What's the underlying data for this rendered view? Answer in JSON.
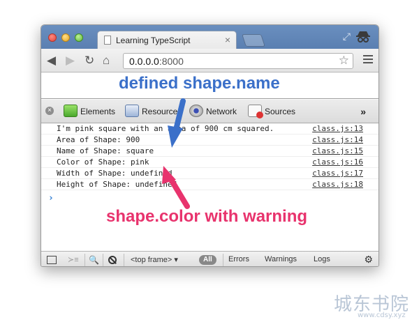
{
  "browser": {
    "tab_title": "Learning TypeScript",
    "tab_close": "×",
    "url_host": "0.0.0.0",
    "url_port": ":8000"
  },
  "devtools": {
    "tabs": [
      {
        "label": "Elements",
        "icon": "elements-icon"
      },
      {
        "label": "Resources",
        "icon": "resources-icon"
      },
      {
        "label": "Network",
        "icon": "network-icon"
      },
      {
        "label": "Sources",
        "icon": "sources-icon"
      }
    ],
    "more": "»"
  },
  "console": {
    "rows": [
      {
        "message": "I'm pink square with an area of 900 cm squared.",
        "source": "class.js:13"
      },
      {
        "message": "Area of Shape: 900",
        "source": "class.js:14"
      },
      {
        "message": "Name of Shape: square",
        "source": "class.js:15"
      },
      {
        "message": "Color of Shape: pink",
        "source": "class.js:16"
      },
      {
        "message": "Width of Shape: undefined",
        "source": "class.js:17"
      },
      {
        "message": "Height of Shape: undefined",
        "source": "class.js:18"
      }
    ],
    "prompt": "›"
  },
  "status_bar": {
    "frame": "<top frame> ▾",
    "filter_all": "All",
    "filter_errors": "Errors",
    "filter_warnings": "Warnings",
    "filter_logs": "Logs"
  },
  "annotations": {
    "top": "defined shape.name",
    "bottom": "shape.color with warning",
    "top_color": "#3b70c9",
    "bottom_color": "#e8336d"
  },
  "watermark": {
    "main": "城东书院",
    "sub": "www.cdsy.xyz"
  }
}
